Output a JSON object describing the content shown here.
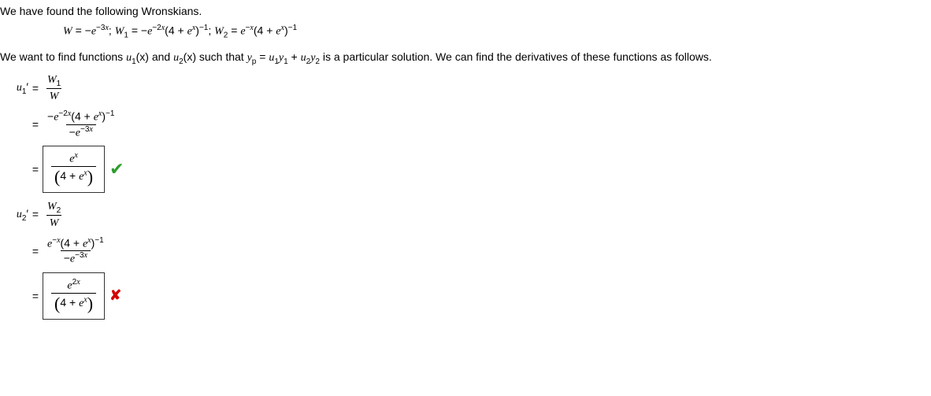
{
  "intro": "We have found the following Wronskians.",
  "sentence2_a": "We want to find functions ",
  "sentence2_b": " and ",
  "sentence2_c": " such that ",
  "sentence2_d": " is a particular solution. We can find the derivatives of these functions as follows.",
  "sym": {
    "W": "W",
    "W1": "W",
    "W2": "W",
    "u": "u",
    "y": "y",
    "x": "x",
    "e": "e",
    "p": "p",
    "eq": " = ",
    "neg": "−",
    "plus": " + ",
    "semicolon": ";  ",
    "prime": "′",
    "four": "4",
    "one": "1",
    "two": "2",
    "three": "3",
    "sub1": "1",
    "sub2": "2"
  },
  "answers": {
    "u1_num": "e",
    "u1_den_a": "4 + ",
    "u1_den_b": "e",
    "u2_num": "e",
    "u2_den_a": "4 + ",
    "u2_den_b": "e"
  },
  "exp": {
    "neg3x": "−3",
    "neg2x": "−2",
    "negx": "−",
    "x": "x",
    "twox": "2",
    "inv": "−1"
  },
  "fn": {
    "u1x": "(x)",
    "u2x": "(x)"
  },
  "icons": {
    "check": "✔",
    "cross": "✘"
  },
  "chart_data": {
    "type": "table",
    "title": "Wronskians and derivative formulas",
    "wronskians": {
      "W": "-e^(-3x)",
      "W1": "-e^(-2x)(4+e^x)^(-1)",
      "W2": "e^(-x)(4+e^x)^(-1)"
    },
    "u1_prime": {
      "formula": "W1 / W",
      "substituted": "(-e^(-2x)(4+e^x)^(-1)) / (-e^(-3x))",
      "answer_entered": "e^x / (4 + e^x)",
      "correct": true
    },
    "u2_prime": {
      "formula": "W2 / W",
      "substituted": "(e^(-x)(4+e^x)^(-1)) / (-e^(-3x))",
      "answer_entered": "e^(2x) / (4 + e^x)",
      "correct": false
    }
  }
}
